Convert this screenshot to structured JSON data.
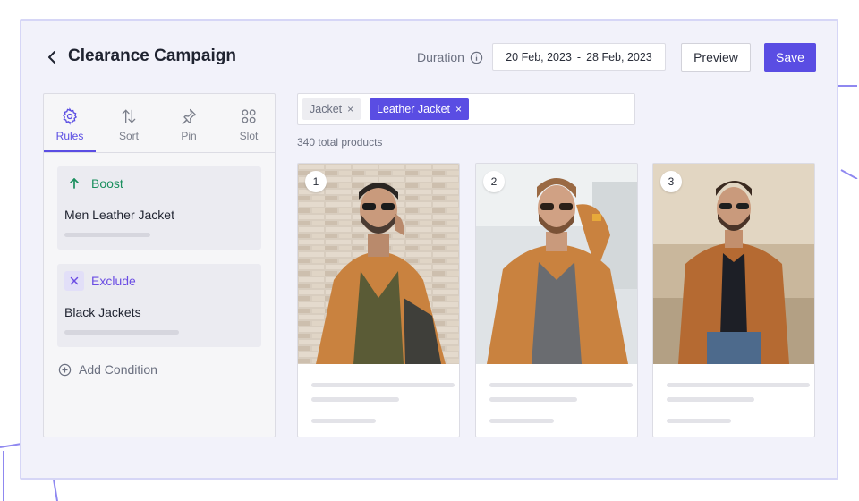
{
  "header": {
    "title": "Clearance Campaign",
    "duration_label": "Duration",
    "date_start": "20 Feb, 2023",
    "date_sep": "-",
    "date_end": "28 Feb, 2023",
    "preview_label": "Preview",
    "save_label": "Save"
  },
  "tabs": [
    {
      "label": "Rules",
      "icon": "gear-icon",
      "active": true
    },
    {
      "label": "Sort",
      "icon": "sort-arrows-icon",
      "active": false
    },
    {
      "label": "Pin",
      "icon": "pin-icon",
      "active": false
    },
    {
      "label": "Slot",
      "icon": "grid-icon",
      "active": false
    }
  ],
  "rules": [
    {
      "type_label": "Boost",
      "icon": "arrow-up-icon",
      "color": "#1a8f5e",
      "name": "Men Leather Jacket",
      "progress": 0.45
    },
    {
      "type_label": "Exclude",
      "icon": "x-icon",
      "color": "#6b4de3",
      "name": "Black Jackets",
      "progress": 0.62
    }
  ],
  "add_condition_label": "Add Condition",
  "filters": [
    {
      "label": "Jacket",
      "x": "×"
    },
    {
      "label": "Leather Jacket",
      "x": "×"
    }
  ],
  "total_products": "340 total products",
  "products": [
    {
      "rank": "1"
    },
    {
      "rank": "2"
    },
    {
      "rank": "3"
    }
  ],
  "colors": {
    "primary": "#5a4de3",
    "boost": "#1a8f5e",
    "exclude": "#6b4de3"
  }
}
